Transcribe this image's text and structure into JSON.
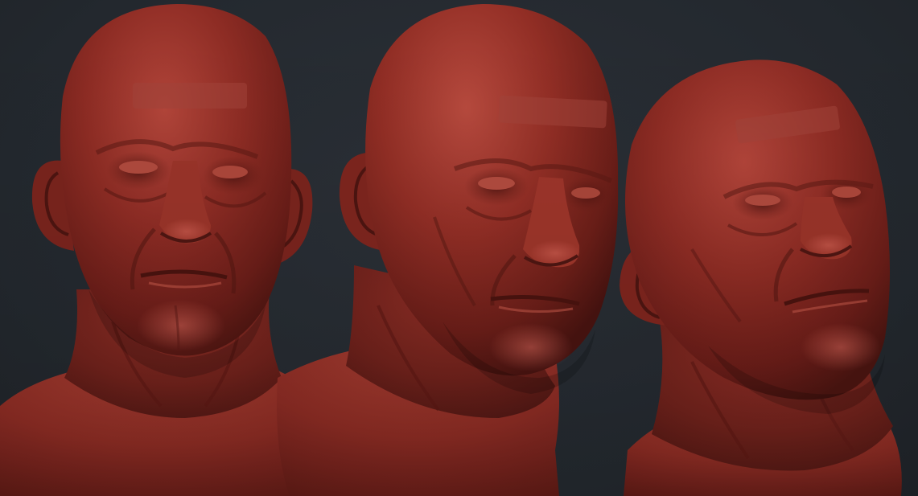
{
  "scene": {
    "background_color": "#252a30",
    "material_color": "#8a2a22",
    "views": [
      {
        "name": "front-view"
      },
      {
        "name": "three-quarter-view"
      },
      {
        "name": "tilted-side-view"
      }
    ]
  }
}
